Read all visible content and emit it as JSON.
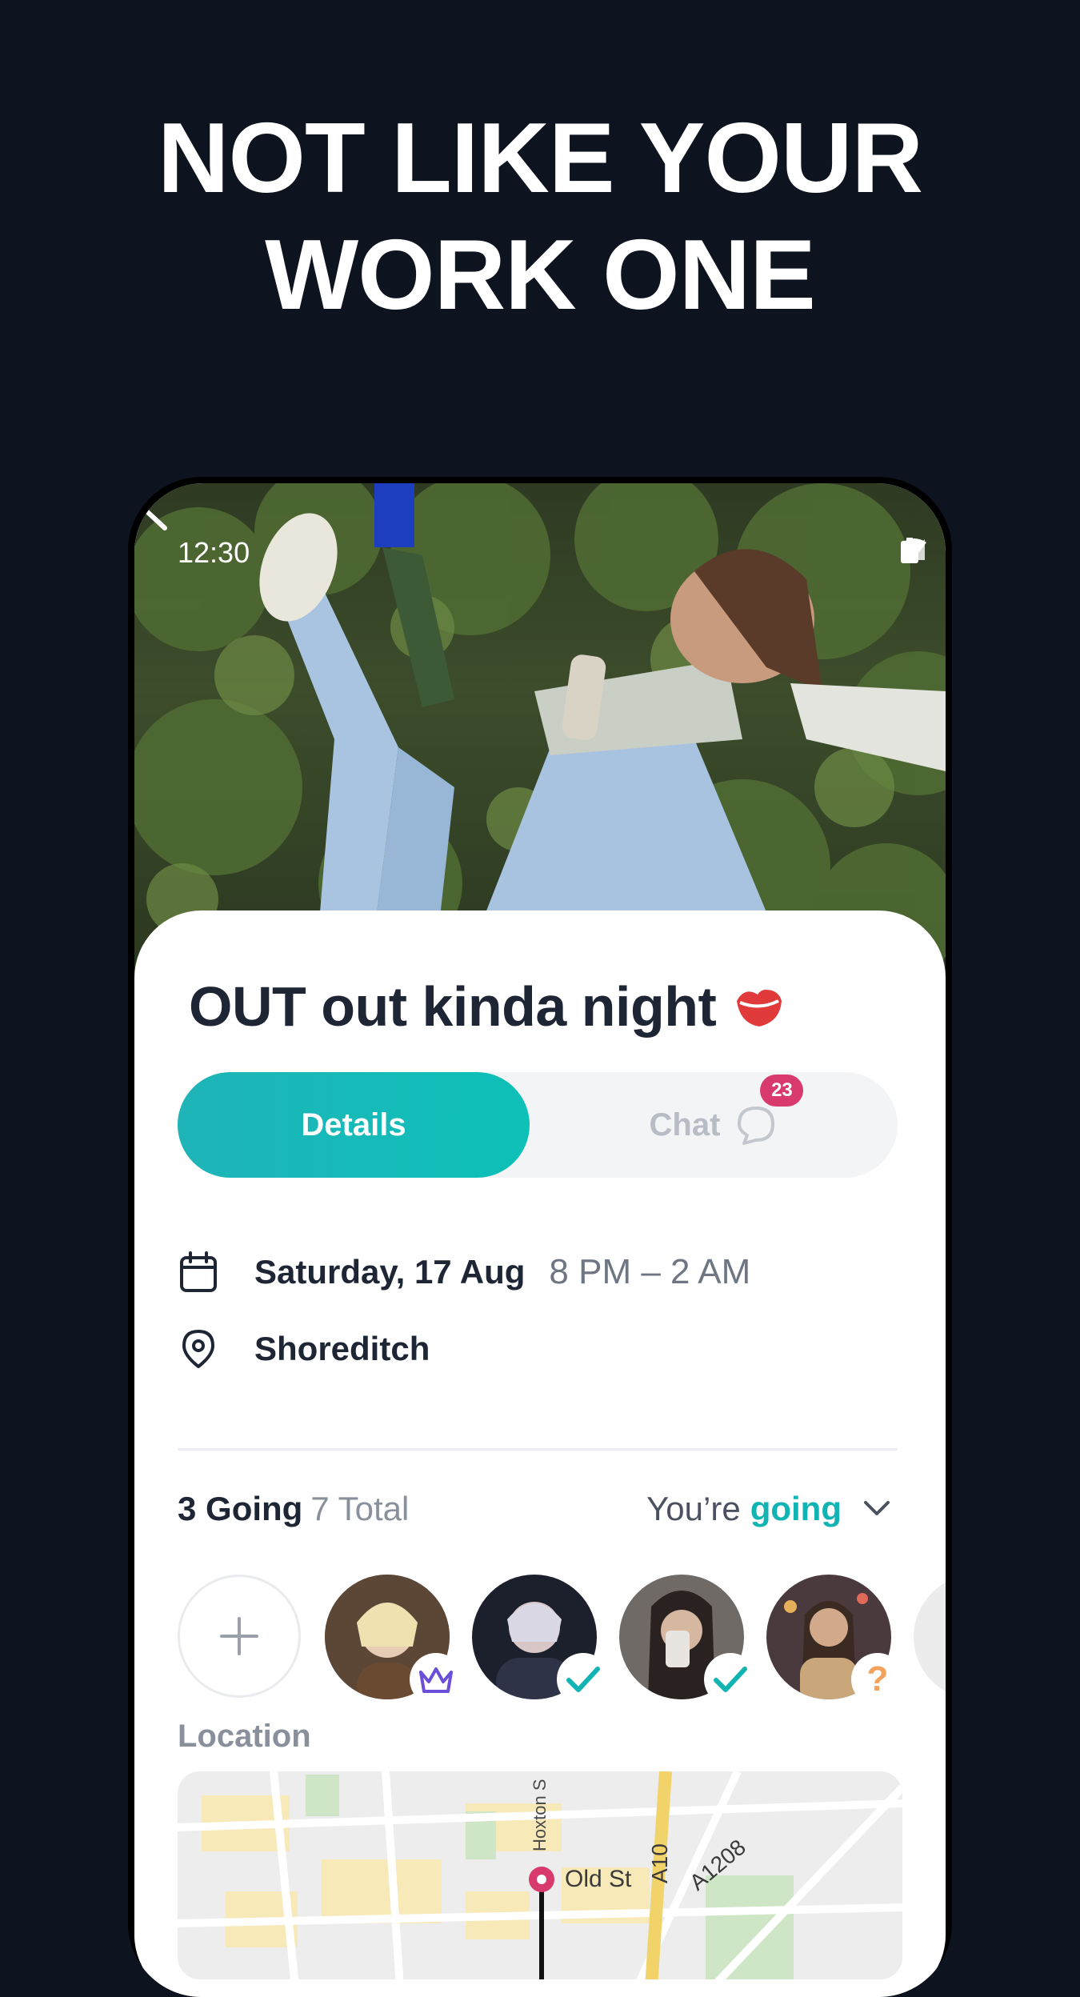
{
  "headline": {
    "line1": "NOT LIKE YOUR",
    "line2": "WORK ONE"
  },
  "status_bar": {
    "time": "12:30"
  },
  "event": {
    "title": "OUT out kinda night",
    "title_emoji": "lips-icon",
    "tabs": {
      "details": "Details",
      "chat": "Chat",
      "chat_badge": "23"
    },
    "date": "Saturday, 17 Aug",
    "time_range": "8 PM – 2 AM",
    "location": "Shoreditch"
  },
  "attendance": {
    "going_label": "3 Going",
    "total_label": "7 Total",
    "rsvp_prefix": "You’re",
    "rsvp_status": "going",
    "avatars": [
      {
        "name": "host-avatar",
        "badge": "crown-icon"
      },
      {
        "name": "guest-avatar",
        "badge": "check-icon"
      },
      {
        "name": "guest-avatar",
        "badge": "check-icon"
      },
      {
        "name": "guest-avatar",
        "badge": "question-icon",
        "badge_text": "?"
      }
    ]
  },
  "location_section": {
    "label": "Location",
    "map_labels": {
      "street1": "Hoxton S",
      "street2": "Old St",
      "road1": "A10",
      "road2": "A1208"
    }
  },
  "colors": {
    "accent": "#12b3b3",
    "badge": "#d93a6e",
    "crown": "#6b4fd8",
    "question": "#f2a25c",
    "background": "#0e1320"
  }
}
